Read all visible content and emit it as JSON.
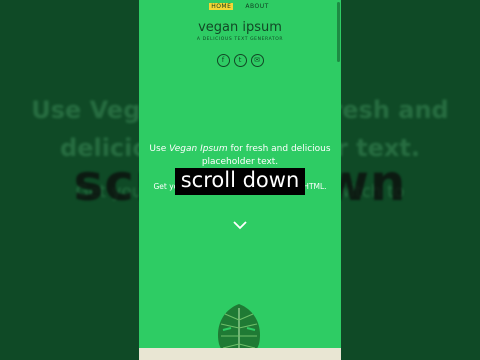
{
  "background": {
    "line1": "Use Vegan Ipsum for fresh and",
    "line2": "delicious placeholder text.",
    "line3": "Get your placeholder text, or switch to",
    "caption": "scroll down"
  },
  "nav": {
    "items": [
      {
        "label": "HOME"
      },
      {
        "label": "ABOUT"
      }
    ]
  },
  "site": {
    "title": "vegan ipsum",
    "tagline": "A DELICIOUS TEXT GENERATOR"
  },
  "socials": [
    {
      "icon": "facebook-icon",
      "glyph": "f"
    },
    {
      "icon": "twitter-icon",
      "glyph": "t"
    },
    {
      "icon": "email-icon",
      "glyph": "✉"
    }
  ],
  "hero": {
    "prefix": "Use ",
    "brand": "Vegan Ipsum",
    "suffix": " for fresh and delicious placeholder text.",
    "sub_before": "Get you",
    "sub_after": "witch to HTML."
  },
  "caption": {
    "text": "scroll down"
  },
  "colors": {
    "screen": "#2ecc64",
    "accent": "#f5d635",
    "dark": "#124826"
  }
}
